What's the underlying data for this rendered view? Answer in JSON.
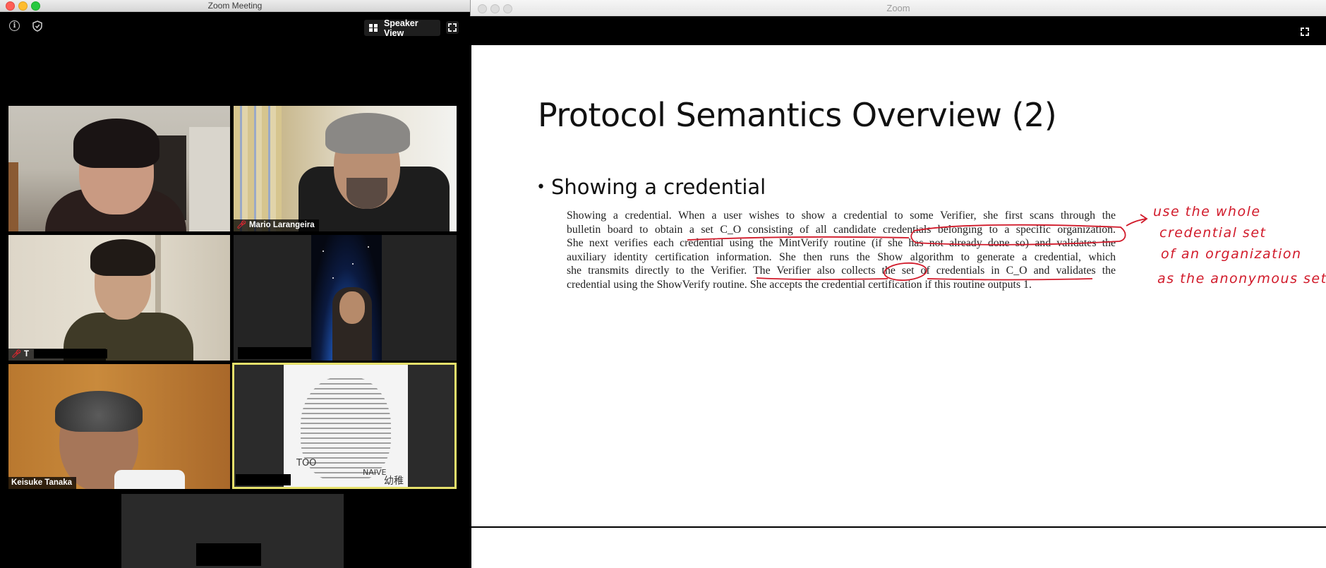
{
  "left_window": {
    "title": "Zoom Meeting",
    "speaker_view_label": "Speaker View",
    "participants": [
      {
        "name": ""
      },
      {
        "name": "Mario Larangeira"
      },
      {
        "name": "T"
      },
      {
        "name": ""
      },
      {
        "name": "Keisuke Tanaka"
      },
      {
        "name": "",
        "portrait_words": [
          "TOO",
          "NAIVE",
          "幼稚"
        ]
      }
    ]
  },
  "right_window": {
    "title": "Zoom",
    "slide": {
      "title": "Protocol Semantics Overview (2)",
      "bullet": "Showing a credential",
      "paragraph_lines": [
        "Showing a credential. When a user wishes to show a credential to some Verifier, she first scans through the",
        "bulletin board to obtain a set C_O consisting of all candidate credentials belonging to a specific organization.",
        "She next verifies each credential using the MintVerify routine (if she has not already done so) and validates the",
        "auxiliary identity certification information. She then runs the Show algorithm to generate a credential, which",
        "she transmits directly to the Verifier. The Verifier also collects the set of credentials in C_O and validates the",
        "credential using the ShowVerify routine. She accepts the credential certification if this routine outputs 1."
      ],
      "handwritten_notes": [
        "use the whole",
        "credential set",
        "of an organization",
        "as the anonymous set."
      ]
    }
  },
  "colors": {
    "annotation": "#d11a2a",
    "active_speaker_border": "#e6e06b",
    "mute": "#e0262e"
  }
}
